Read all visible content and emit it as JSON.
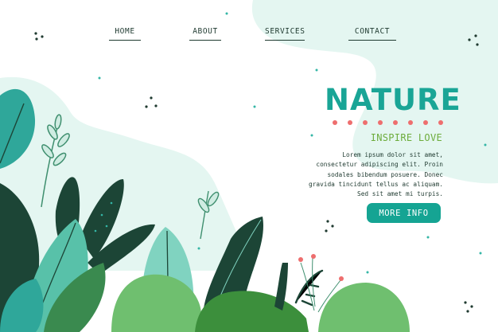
{
  "nav": {
    "items": [
      {
        "label": "HOME"
      },
      {
        "label": "ABOUT"
      },
      {
        "label": "SERVICES"
      },
      {
        "label": "CONTACT"
      }
    ]
  },
  "hero": {
    "title": "NATURE",
    "subtitle": "INSPIRE LOVE",
    "body": "Lorem ipsum dolor sit amet, consectetur adipiscing elit. Proin sodales bibendum posuere. Donec gravida tincidunt tellus ac aliquam. Sed sit amet mi turpis.",
    "cta_label": "MORE INFO"
  },
  "colors": {
    "accent": "#15a493",
    "title": "#1aa596",
    "subtitle": "#6dac3c",
    "dots": "#ee6e6e",
    "dark_leaf": "#1f3a30",
    "background_wash": "#e4f6f1"
  },
  "decor": {
    "title_dot_count": 8,
    "illustration": "plant-foliage-illustration"
  }
}
